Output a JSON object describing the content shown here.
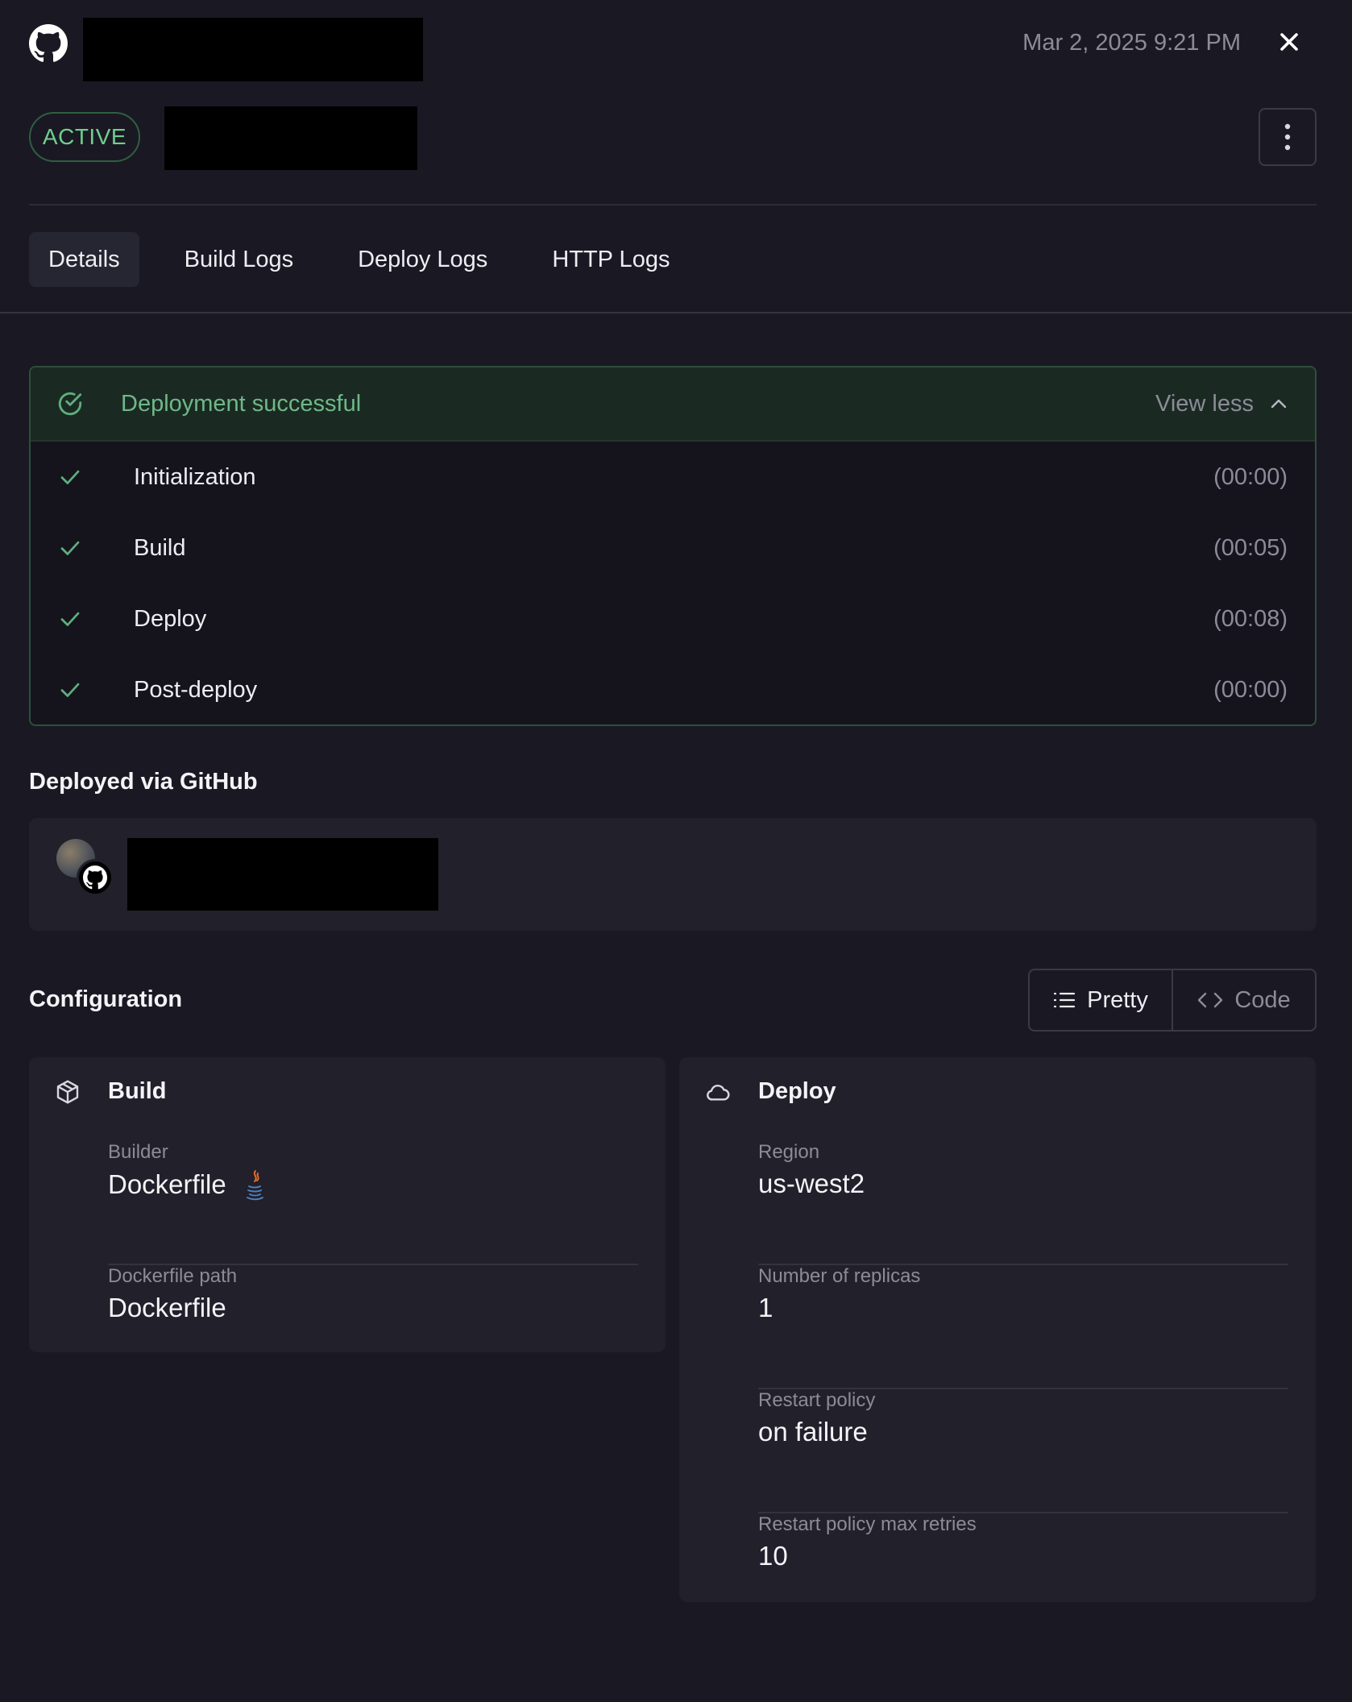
{
  "header": {
    "timestamp": "Mar 2, 2025 9:21 PM",
    "status": "ACTIVE"
  },
  "tabs": [
    {
      "label": "Details",
      "active": true
    },
    {
      "label": "Build Logs",
      "active": false
    },
    {
      "label": "Deploy Logs",
      "active": false
    },
    {
      "label": "HTTP Logs",
      "active": false
    }
  ],
  "deployment": {
    "title": "Deployment successful",
    "toggle_label": "View less",
    "steps": [
      {
        "label": "Initialization",
        "time": "(00:00)"
      },
      {
        "label": "Build",
        "time": "(00:05)"
      },
      {
        "label": "Deploy",
        "time": "(00:08)"
      },
      {
        "label": "Post-deploy",
        "time": "(00:00)"
      }
    ]
  },
  "source": {
    "title": "Deployed via GitHub"
  },
  "configuration": {
    "title": "Configuration",
    "view_options": {
      "pretty": "Pretty",
      "code": "Code",
      "selected": "Pretty"
    },
    "build": {
      "title": "Build",
      "builder_label": "Builder",
      "builder_value": "Dockerfile",
      "path_label": "Dockerfile path",
      "path_value": "Dockerfile"
    },
    "deploy": {
      "title": "Deploy",
      "region_label": "Region",
      "region_value": "us-west2",
      "replicas_label": "Number of replicas",
      "replicas_value": "1",
      "restart_label": "Restart policy",
      "restart_value": "on failure",
      "retries_label": "Restart policy max retries",
      "retries_value": "10"
    }
  },
  "colors": {
    "background": "#1a1923",
    "success": "#6fcf8f",
    "muted": "#8c8b98"
  }
}
